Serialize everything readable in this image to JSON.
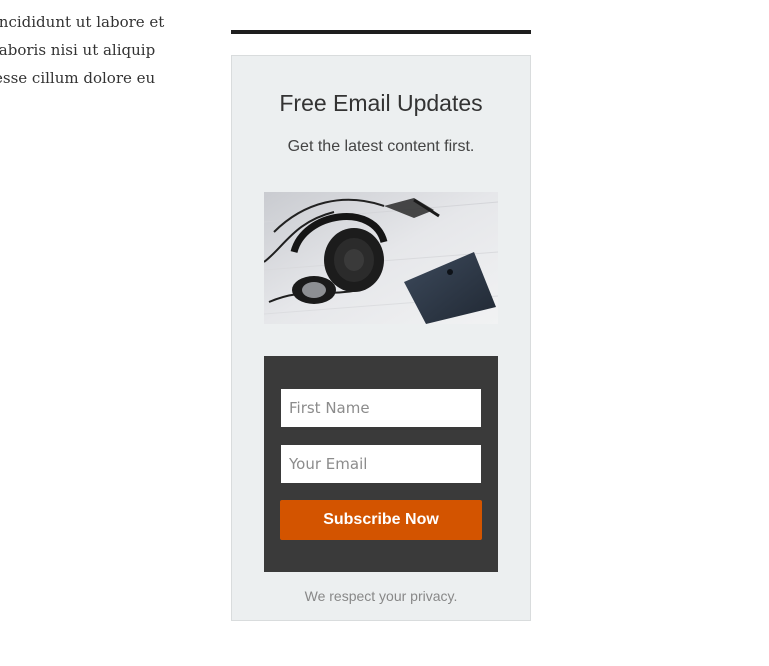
{
  "article": {
    "lines": [
      "incididunt ut labore et",
      "laboris nisi ut aliquip",
      "esse cillum dolore eu"
    ]
  },
  "optin": {
    "title": "Free Email Updates",
    "subtitle": "Get the latest content first.",
    "image_subject": "headphones-and-smartphone-photo",
    "form": {
      "first_name_placeholder": "First Name",
      "first_name_value": "",
      "email_placeholder": "Your Email",
      "email_value": "",
      "submit_label": "Subscribe Now"
    },
    "privacy_note": "We respect your privacy."
  },
  "colors": {
    "accent": "#d35400",
    "form_background": "#3a3a3a",
    "widget_background": "#eceff0",
    "rule": "#1e1e1e"
  }
}
